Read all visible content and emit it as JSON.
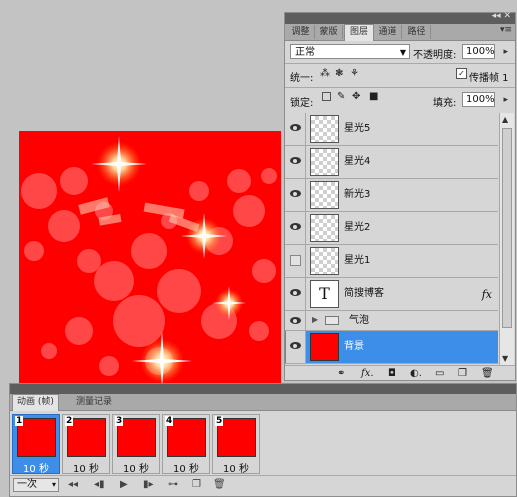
{
  "layers_panel": {
    "collapse_glyph": "◂◂ ✕",
    "tabs": [
      "调整",
      "蒙版",
      "图层",
      "通道",
      "路径"
    ],
    "menu_glyph": "▾≡",
    "blend_mode": "正常",
    "opacity_label": "不透明度:",
    "opacity_value": "100%",
    "unify_label": "统一:",
    "propagate_label": "传播帧 1",
    "lock_label": "锁定:",
    "fill_label": "填充:",
    "fill_value": "100%",
    "layers": [
      {
        "name": "星光5",
        "visible": true,
        "thumb": "transparent"
      },
      {
        "name": "星光4",
        "visible": true,
        "thumb": "transparent"
      },
      {
        "name": "新光3",
        "visible": true,
        "thumb": "transparent"
      },
      {
        "name": "星光2",
        "visible": true,
        "thumb": "transparent"
      },
      {
        "name": "星光1",
        "visible": false,
        "thumb": "transparent"
      },
      {
        "name": "简搜博客",
        "visible": true,
        "thumb": "text",
        "thumb_glyph": "T",
        "fx": "fx"
      },
      {
        "name": "气泡",
        "visible": true,
        "thumb": "folder"
      },
      {
        "name": "背景",
        "visible": true,
        "thumb": "red",
        "selected": true
      }
    ],
    "footer_icons": [
      "link-icon",
      "fx-icon",
      "mask-icon",
      "adjustment-icon",
      "group-icon",
      "new-layer-icon",
      "trash-icon"
    ],
    "footer_glyphs": [
      "⚭",
      "fx.",
      "◘",
      "◐.",
      "▭",
      "❐",
      "🗑"
    ]
  },
  "animation_panel": {
    "tabs": [
      "动画 (帧)",
      "测量记录"
    ],
    "frames": [
      {
        "number": "1",
        "delay": "10 秒"
      },
      {
        "number": "2",
        "delay": "10 秒"
      },
      {
        "number": "3",
        "delay": "10 秒"
      },
      {
        "number": "4",
        "delay": "10 秒"
      },
      {
        "number": "5",
        "delay": "10 秒"
      }
    ],
    "loop_value": "一次",
    "control_glyphs": [
      "◂◂",
      "◂▮",
      "▶",
      "▮▸",
      "⊶",
      "❐",
      "🗑"
    ]
  },
  "canvas": {
    "background_color": "#ff0000"
  }
}
